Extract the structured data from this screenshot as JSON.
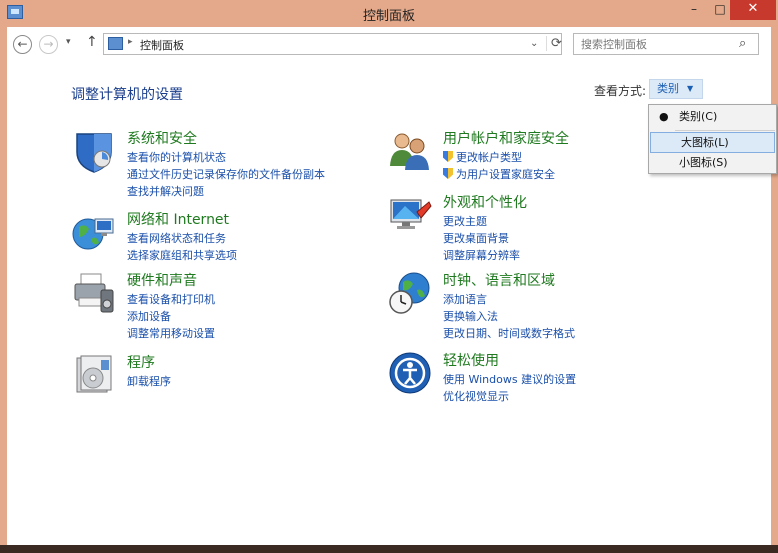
{
  "window": {
    "title": "控制面板",
    "minimize": "–",
    "maximize": "□",
    "close": "✕"
  },
  "nav": {
    "back": "←",
    "forward": "→",
    "recent": "▾",
    "up": "↑",
    "address_separator": "▸",
    "address": "控制面板",
    "address_chevron": "⌄",
    "refresh": "⟳"
  },
  "search": {
    "placeholder": "搜索控制面板",
    "icon": "⌕"
  },
  "page": {
    "heading": "调整计算机的设置",
    "view_by_label": "查看方式:",
    "view_by_value": "类别",
    "view_by_caret": "▼"
  },
  "view_menu": {
    "bullet": "●",
    "items": [
      "类别(C)",
      "大图标(L)",
      "小图标(S)"
    ],
    "selected_index": 0,
    "hover_index": 1
  },
  "categories": {
    "system": {
      "title": "系统和安全",
      "links": [
        "查看你的计算机状态",
        "通过文件历史记录保存你的文件备份副本",
        "查找并解决问题"
      ],
      "icon": "shield-icon"
    },
    "network": {
      "title": "网络和 Internet",
      "links": [
        "查看网络状态和任务",
        "选择家庭组和共享选项"
      ],
      "icon": "globe-network-icon"
    },
    "hardware": {
      "title": "硬件和声音",
      "links": [
        "查看设备和打印机",
        "添加设备",
        "调整常用移动设置"
      ],
      "icon": "printer-icon"
    },
    "programs": {
      "title": "程序",
      "links": [
        "卸载程序"
      ],
      "icon": "programs-icon"
    },
    "users": {
      "title": "用户帐户和家庭安全",
      "links": [
        "更改帐户类型",
        "为用户设置家庭安全"
      ],
      "icon": "users-icon"
    },
    "appearance": {
      "title": "外观和个性化",
      "links": [
        "更改主题",
        "更改桌面背景",
        "调整屏幕分辨率"
      ],
      "icon": "monitor-icon"
    },
    "clock": {
      "title": "时钟、语言和区域",
      "links": [
        "添加语言",
        "更换输入法",
        "更改日期、时间或数字格式"
      ],
      "icon": "clock-globe-icon"
    },
    "ease": {
      "title": "轻松使用",
      "links": [
        "使用 Windows 建议的设置",
        "优化视觉显示"
      ],
      "icon": "ease-of-access-icon"
    }
  },
  "colors": {
    "title_bar": "#e4a98a",
    "close_button": "#c7392c",
    "heading": "#1a3e8c",
    "category_title": "#1f7a1f",
    "link": "#1a4faa"
  }
}
